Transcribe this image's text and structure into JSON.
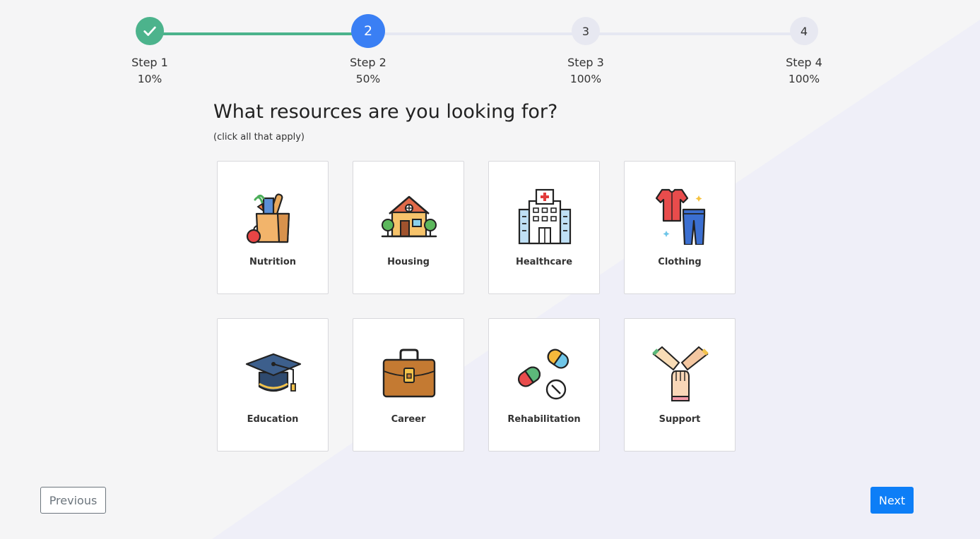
{
  "stepper": {
    "steps": [
      {
        "label": "Step 1",
        "percent": "10%",
        "number": "1",
        "state": "done"
      },
      {
        "label": "Step 2",
        "percent": "50%",
        "number": "2",
        "state": "active"
      },
      {
        "label": "Step 3",
        "percent": "100%",
        "number": "3",
        "state": "pending"
      },
      {
        "label": "Step 4",
        "percent": "100%",
        "number": "4",
        "state": "pending"
      }
    ]
  },
  "question": {
    "title": "What resources are you looking for?",
    "subtitle": "(click all that apply)"
  },
  "categories": [
    {
      "label": "Nutrition",
      "icon": "grocery-bag-icon"
    },
    {
      "label": "Housing",
      "icon": "house-icon"
    },
    {
      "label": "Healthcare",
      "icon": "hospital-icon"
    },
    {
      "label": "Clothing",
      "icon": "clothes-icon"
    },
    {
      "label": "Education",
      "icon": "graduation-cap-icon"
    },
    {
      "label": "Career",
      "icon": "briefcase-icon"
    },
    {
      "label": "Rehabilitation",
      "icon": "pills-icon"
    },
    {
      "label": "Support",
      "icon": "joined-hands-icon"
    }
  ],
  "nav": {
    "previous_label": "Previous",
    "next_label": "Next"
  },
  "colors": {
    "step_done": "#4cb38c",
    "step_active": "#3a7ff4",
    "step_pending": "#e7e8f1",
    "next_button": "#0d7ef7"
  }
}
